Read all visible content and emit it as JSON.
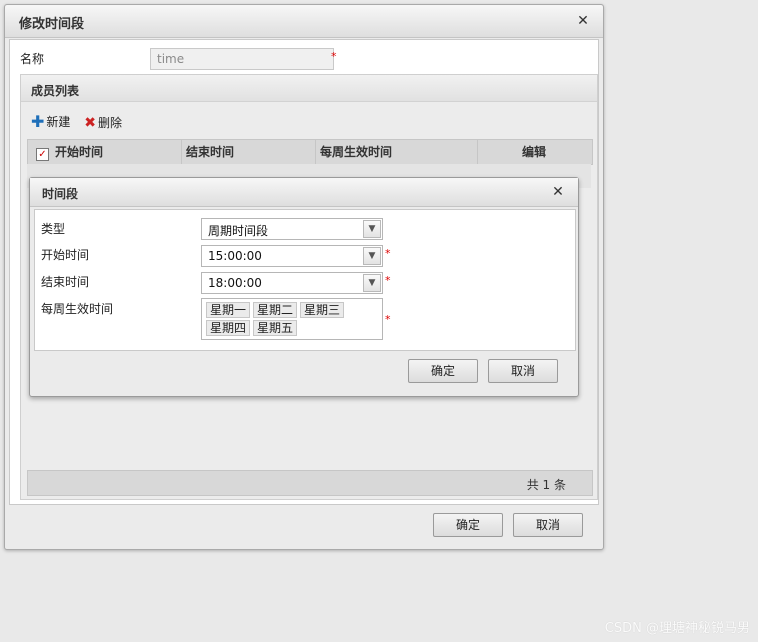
{
  "outer_dialog": {
    "title": "修改时间段",
    "name_label": "名称",
    "name_value": "time",
    "required_mark": "*",
    "member_panel": {
      "title": "成员列表",
      "toolbar": {
        "new_label": "新建",
        "delete_label": "删除"
      },
      "columns": [
        "开始时间",
        "结束时间",
        "每周生效时间",
        "编辑"
      ],
      "total_text": "共 1 条"
    },
    "ok_label": "确定",
    "cancel_label": "取消"
  },
  "inner_dialog": {
    "title": "时间段",
    "fields": {
      "type_label": "类型",
      "type_value": "周期时间段",
      "start_label": "开始时间",
      "start_value": "15:00:00",
      "end_label": "结束时间",
      "end_value": "18:00:00",
      "weekdays_label": "每周生效时间",
      "weekdays": [
        "星期一",
        "星期二",
        "星期三",
        "星期四",
        "星期五"
      ]
    },
    "ok_label": "确定",
    "cancel_label": "取消"
  },
  "watermark": "CSDN @理塘神秘锐马男",
  "icons": {
    "close": "close-icon",
    "add": "plus-icon",
    "delete": "x-icon",
    "checkbox": "checkbox-icon",
    "dropdown": "chevron-down-icon"
  },
  "colors": {
    "required": "#dd0000",
    "add_icon": "#1f6fb9",
    "delete_icon": "#cc2222"
  }
}
